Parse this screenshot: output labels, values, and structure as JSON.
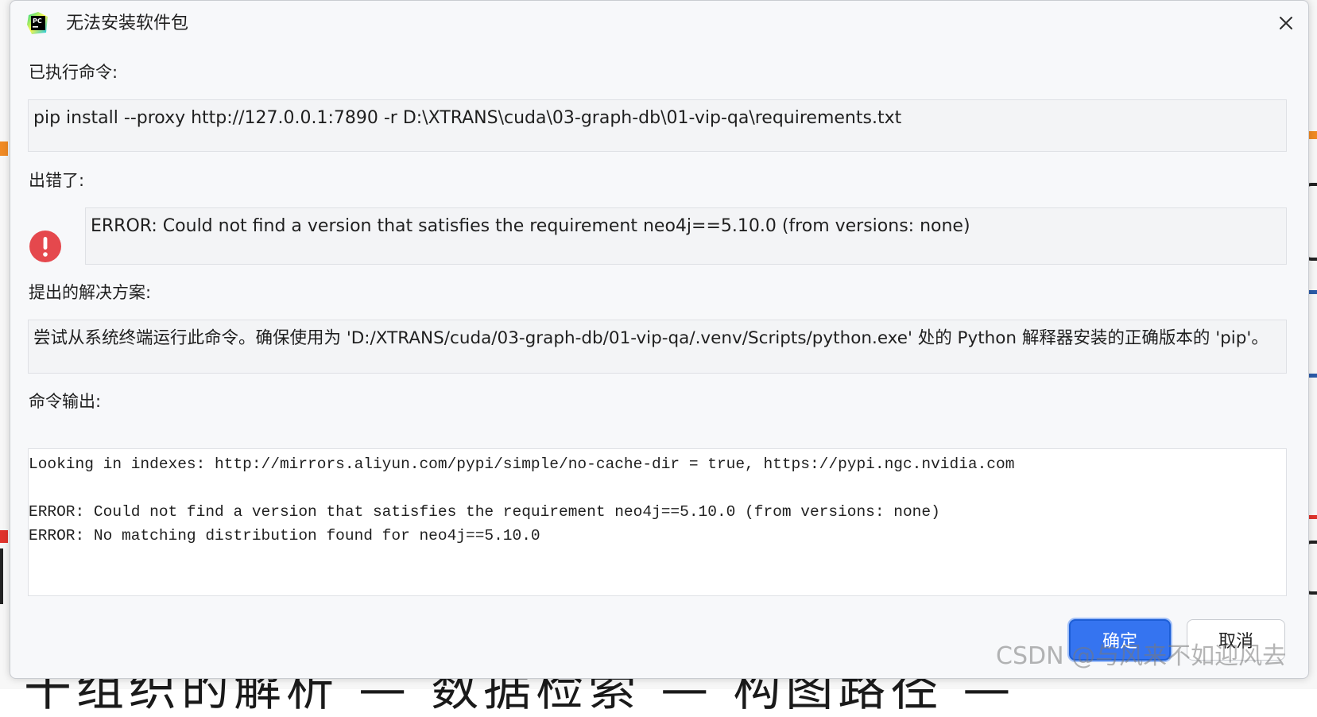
{
  "window": {
    "title": "无法安装软件包",
    "close_icon": "close-icon",
    "app_icon": "pycharm-logo-icon",
    "app_icon_text": "PC"
  },
  "executed": {
    "label": "已执行命令:",
    "command": "pip install --proxy http://127.0.0.1:7890 -r D:\\XTRANS\\cuda\\03-graph-db\\01-vip-qa\\requirements.txt"
  },
  "error": {
    "label": "出错了:",
    "icon": "error-icon",
    "message": "ERROR: Could not find a version that satisfies the requirement neo4j==5.10.0 (from versions: none)"
  },
  "solution": {
    "label": "提出的解决方案:",
    "text": "尝试从系统终端运行此命令。确保使用为 'D:/XTRANS/cuda/03-graph-db/01-vip-qa/.venv/Scripts/python.exe' 处的 Python 解释器安装的正确版本的 'pip'。"
  },
  "output": {
    "label": "命令输出:",
    "lines": [
      "Looking in indexes: http://mirrors.aliyun.com/pypi/simple/no-cache-dir = true, https://pypi.ngc.nvidia.com",
      "",
      "ERROR: Could not find a version that satisfies the requirement neo4j==5.10.0 (from versions: none)",
      "ERROR: No matching distribution found for neo4j==5.10.0"
    ]
  },
  "buttons": {
    "ok": "确定",
    "cancel": "取消"
  },
  "watermark": "CSDN @与风来不如迎风去",
  "background_text": "干组织的解析 — 数据检索  — 构图路径 —",
  "colors": {
    "primary_button": "#3574f0",
    "error_icon": "#e5484d",
    "dialog_bg": "#f7f8fa"
  }
}
